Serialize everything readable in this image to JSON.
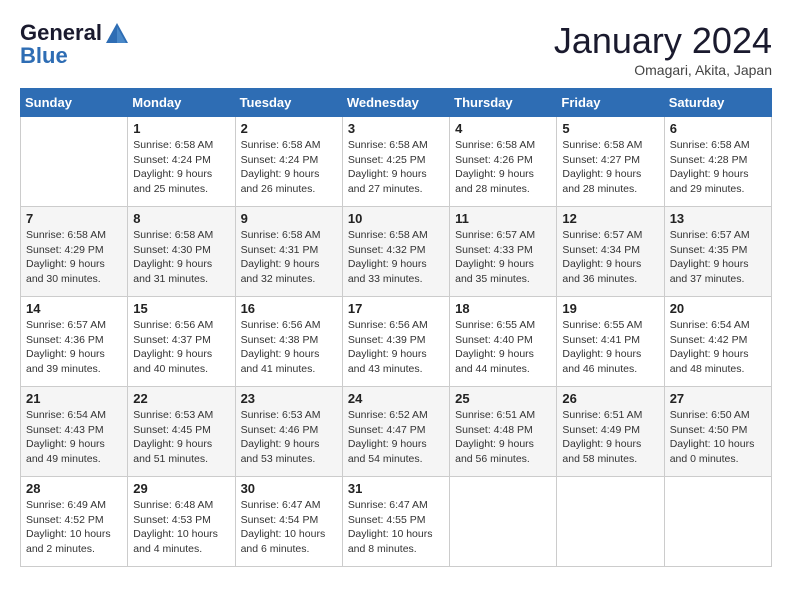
{
  "logo": {
    "line1": "General",
    "line2": "Blue"
  },
  "title": "January 2024",
  "location": "Omagari, Akita, Japan",
  "days_of_week": [
    "Sunday",
    "Monday",
    "Tuesday",
    "Wednesday",
    "Thursday",
    "Friday",
    "Saturday"
  ],
  "weeks": [
    [
      {
        "day": "",
        "content": ""
      },
      {
        "day": "1",
        "content": "Sunrise: 6:58 AM\nSunset: 4:24 PM\nDaylight: 9 hours\nand 25 minutes."
      },
      {
        "day": "2",
        "content": "Sunrise: 6:58 AM\nSunset: 4:24 PM\nDaylight: 9 hours\nand 26 minutes."
      },
      {
        "day": "3",
        "content": "Sunrise: 6:58 AM\nSunset: 4:25 PM\nDaylight: 9 hours\nand 27 minutes."
      },
      {
        "day": "4",
        "content": "Sunrise: 6:58 AM\nSunset: 4:26 PM\nDaylight: 9 hours\nand 28 minutes."
      },
      {
        "day": "5",
        "content": "Sunrise: 6:58 AM\nSunset: 4:27 PM\nDaylight: 9 hours\nand 28 minutes."
      },
      {
        "day": "6",
        "content": "Sunrise: 6:58 AM\nSunset: 4:28 PM\nDaylight: 9 hours\nand 29 minutes."
      }
    ],
    [
      {
        "day": "7",
        "content": ""
      },
      {
        "day": "8",
        "content": "Sunrise: 6:58 AM\nSunset: 4:30 PM\nDaylight: 9 hours\nand 31 minutes."
      },
      {
        "day": "9",
        "content": "Sunrise: 6:58 AM\nSunset: 4:31 PM\nDaylight: 9 hours\nand 32 minutes."
      },
      {
        "day": "10",
        "content": "Sunrise: 6:58 AM\nSunset: 4:32 PM\nDaylight: 9 hours\nand 33 minutes."
      },
      {
        "day": "11",
        "content": "Sunrise: 6:57 AM\nSunset: 4:33 PM\nDaylight: 9 hours\nand 35 minutes."
      },
      {
        "day": "12",
        "content": "Sunrise: 6:57 AM\nSunset: 4:34 PM\nDaylight: 9 hours\nand 36 minutes."
      },
      {
        "day": "13",
        "content": "Sunrise: 6:57 AM\nSunset: 4:35 PM\nDaylight: 9 hours\nand 37 minutes."
      }
    ],
    [
      {
        "day": "14",
        "content": ""
      },
      {
        "day": "15",
        "content": "Sunrise: 6:56 AM\nSunset: 4:37 PM\nDaylight: 9 hours\nand 40 minutes."
      },
      {
        "day": "16",
        "content": "Sunrise: 6:56 AM\nSunset: 4:38 PM\nDaylight: 9 hours\nand 41 minutes."
      },
      {
        "day": "17",
        "content": "Sunrise: 6:56 AM\nSunset: 4:39 PM\nDaylight: 9 hours\nand 43 minutes."
      },
      {
        "day": "18",
        "content": "Sunrise: 6:55 AM\nSunset: 4:40 PM\nDaylight: 9 hours\nand 44 minutes."
      },
      {
        "day": "19",
        "content": "Sunrise: 6:55 AM\nSunset: 4:41 PM\nDaylight: 9 hours\nand 46 minutes."
      },
      {
        "day": "20",
        "content": "Sunrise: 6:54 AM\nSunset: 4:42 PM\nDaylight: 9 hours\nand 48 minutes."
      }
    ],
    [
      {
        "day": "21",
        "content": ""
      },
      {
        "day": "22",
        "content": "Sunrise: 6:53 AM\nSunset: 4:45 PM\nDaylight: 9 hours\nand 51 minutes."
      },
      {
        "day": "23",
        "content": "Sunrise: 6:53 AM\nSunset: 4:46 PM\nDaylight: 9 hours\nand 53 minutes."
      },
      {
        "day": "24",
        "content": "Sunrise: 6:52 AM\nSunset: 4:47 PM\nDaylight: 9 hours\nand 54 minutes."
      },
      {
        "day": "25",
        "content": "Sunrise: 6:51 AM\nSunset: 4:48 PM\nDaylight: 9 hours\nand 56 minutes."
      },
      {
        "day": "26",
        "content": "Sunrise: 6:51 AM\nSunset: 4:49 PM\nDaylight: 9 hours\nand 58 minutes."
      },
      {
        "day": "27",
        "content": "Sunrise: 6:50 AM\nSunset: 4:50 PM\nDaylight: 10 hours\nand 0 minutes."
      }
    ],
    [
      {
        "day": "28",
        "content": ""
      },
      {
        "day": "29",
        "content": "Sunrise: 6:48 AM\nSunset: 4:53 PM\nDaylight: 10 hours\nand 4 minutes."
      },
      {
        "day": "30",
        "content": "Sunrise: 6:47 AM\nSunset: 4:54 PM\nDaylight: 10 hours\nand 6 minutes."
      },
      {
        "day": "31",
        "content": "Sunrise: 6:47 AM\nSunset: 4:55 PM\nDaylight: 10 hours\nand 8 minutes."
      },
      {
        "day": "",
        "content": ""
      },
      {
        "day": "",
        "content": ""
      },
      {
        "day": "",
        "content": ""
      }
    ]
  ],
  "week1_sunday": {
    "day": "7",
    "content": "Sunrise: 6:58 AM\nSunset: 4:29 PM\nDaylight: 9 hours\nand 30 minutes."
  },
  "week2_sunday": {
    "day": "14",
    "content": "Sunrise: 6:57 AM\nSunset: 4:36 PM\nDaylight: 9 hours\nand 39 minutes."
  },
  "week3_sunday": {
    "day": "21",
    "content": "Sunrise: 6:54 AM\nSunset: 4:43 PM\nDaylight: 9 hours\nand 49 minutes."
  },
  "week4_sunday": {
    "day": "28",
    "content": "Sunrise: 6:49 AM\nSunset: 4:52 PM\nDaylight: 10 hours\nand 2 minutes."
  }
}
